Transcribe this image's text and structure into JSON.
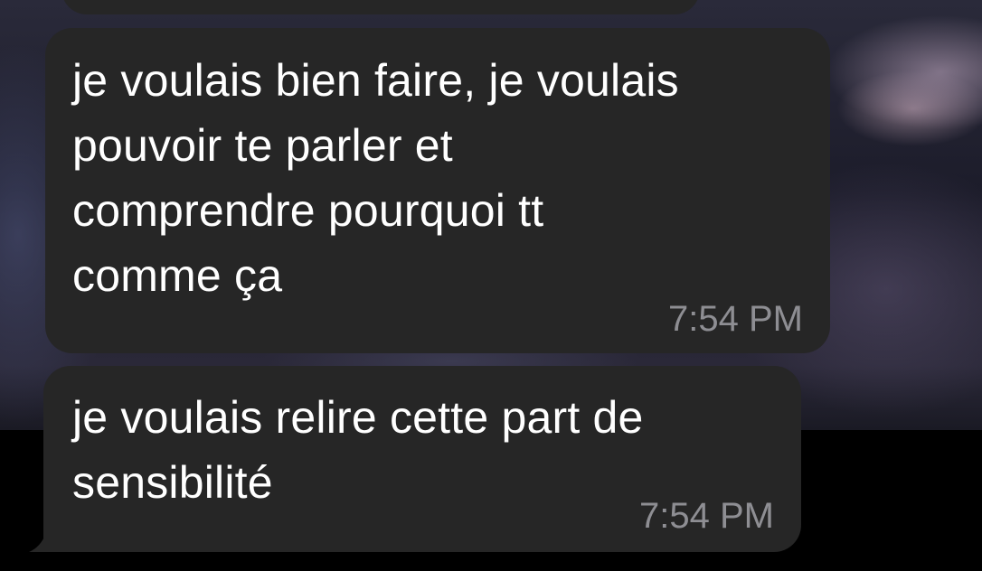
{
  "conversation": {
    "messages": [
      {
        "text": "je voulais bien faire, je voulais\npouvoir te parler et\ncomprendre pourquoi tt\ncomme ça",
        "time": "7:54 PM"
      },
      {
        "text": "je voulais relire cette part de\nsensibilité",
        "time": "7:54 PM"
      }
    ]
  },
  "colors": {
    "bubble_background": "#262626",
    "message_text": "#ffffff",
    "timestamp_text": "#8e8e93",
    "background": "#000000"
  }
}
